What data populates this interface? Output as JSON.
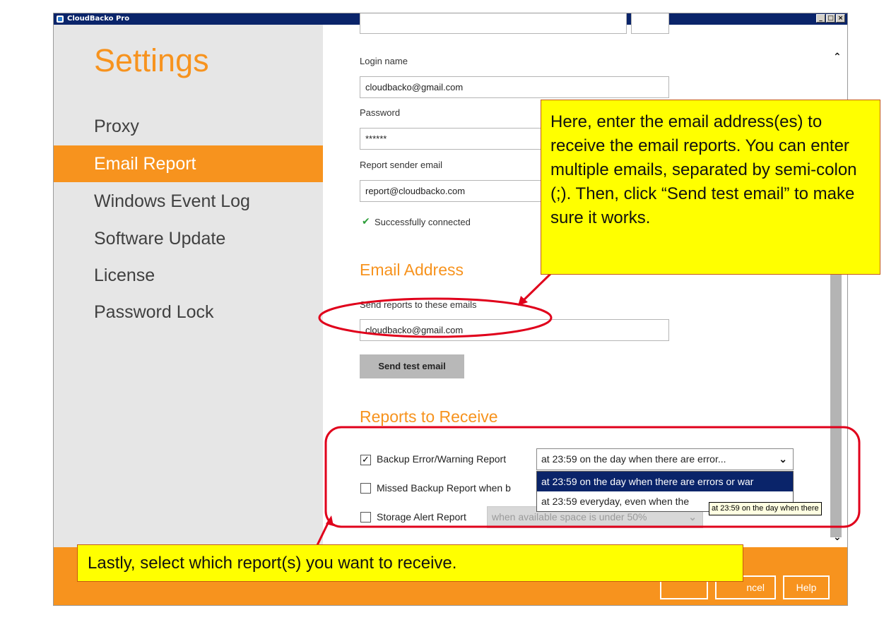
{
  "window": {
    "title": "CloudBacko Pro"
  },
  "sidebar": {
    "title": "Settings",
    "items": [
      {
        "label": "Proxy",
        "active": false
      },
      {
        "label": "Email Report",
        "active": true
      },
      {
        "label": "Windows Event Log",
        "active": false
      },
      {
        "label": "Software Update",
        "active": false
      },
      {
        "label": "License",
        "active": false
      },
      {
        "label": "Password Lock",
        "active": false
      }
    ]
  },
  "smtp": {
    "login_label": "Login name",
    "login_value": "cloudbacko@gmail.com",
    "password_label": "Password",
    "password_value": "******",
    "sender_label": "Report sender email",
    "sender_value": "report@cloudbacko.com",
    "status": "Successfully connected"
  },
  "email_address": {
    "section_title": "Email Address",
    "label": "Send reports to these emails",
    "value": "cloudbacko@gmail.com",
    "test_button": "Send test email"
  },
  "reports": {
    "section_title": "Reports to Receive",
    "backup_error": {
      "label": "Backup Error/Warning Report",
      "checked": true,
      "selected": "at 23:59 on the day when there are error..."
    },
    "missed_backup": {
      "label": "Missed Backup Report when b",
      "checked": false
    },
    "storage_alert": {
      "label": "Storage Alert Report",
      "checked": false,
      "selected": "when available space is under 50%"
    },
    "dropdown_options": [
      "at 23:59 on the day when there are errors or war",
      "at 23:59 everyday, even when the"
    ],
    "tooltip": "at 23:59 on the day when there"
  },
  "footer": {
    "ok_label": "",
    "cancel_label": "ncel",
    "help_label": "Help"
  },
  "callouts": {
    "top": "Here, enter the email address(es) to receive the email reports. You can enter multiple emails, separated by semi-colon (;). Then, click “Send test email” to make sure it works.",
    "bottom": "Lastly, select which report(s) you want to receive."
  },
  "colors": {
    "accent": "#f7931e",
    "sidebar_bg": "#e6e6e6",
    "callout_bg": "#ffff00",
    "annotation": "#e0001b"
  }
}
